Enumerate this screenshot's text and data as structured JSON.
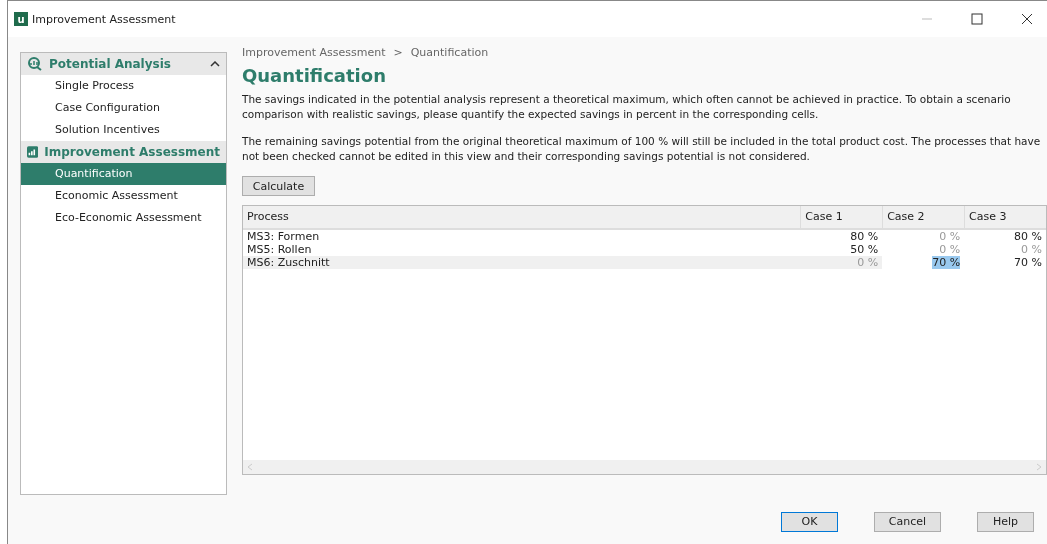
{
  "window": {
    "title": "Improvement Assessment",
    "logo": "u"
  },
  "sidebar": {
    "sections": [
      {
        "kind": "analysis",
        "title": "Potential Analysis",
        "expanded": true,
        "items": [
          {
            "label": "Single Process",
            "selected": false
          },
          {
            "label": "Case Configuration",
            "selected": false
          },
          {
            "label": "Solution Incentives",
            "selected": false
          }
        ]
      },
      {
        "kind": "chart",
        "title": "Improvement Assessment",
        "items": [
          {
            "label": "Quantification",
            "selected": true
          },
          {
            "label": "Economic Assessment",
            "selected": false
          },
          {
            "label": "Eco-Economic Assessment",
            "selected": false
          }
        ]
      }
    ]
  },
  "breadcrumb": [
    "Improvement Assessment",
    "Quantification"
  ],
  "breadcrumb_separator": ">",
  "heading": "Quantification",
  "paragraphs": [
    "The savings indicated in the potential analysis represent a theoretical maximum, which often cannot be achieved in practice. To obtain a scenario comparison with realistic savings, please quantify the expected savings in percent in the corresponding cells.",
    "The remaining savings potential from the original theoretical maximum of 100 % will still be included in the total product cost. The processes that have not been checked cannot be edited in this view and their corresponding savings potential is not considered."
  ],
  "calculate_button": "Calculate",
  "table": {
    "columns": [
      "Process",
      "Case 1",
      "Case 2",
      "Case 3"
    ],
    "rows": [
      {
        "process": "MS3:  Formen",
        "selected": false,
        "cells": [
          {
            "value": "80 %",
            "disabled": false,
            "selected": false
          },
          {
            "value": "0 %",
            "disabled": true,
            "selected": false
          },
          {
            "value": "80 %",
            "disabled": false,
            "selected": false
          }
        ]
      },
      {
        "process": "MS5:  Rollen",
        "selected": false,
        "cells": [
          {
            "value": "50 %",
            "disabled": false,
            "selected": false
          },
          {
            "value": "0 %",
            "disabled": true,
            "selected": false
          },
          {
            "value": "0 %",
            "disabled": true,
            "selected": false
          }
        ]
      },
      {
        "process": "MS6:  Zuschnitt",
        "selected": true,
        "cells": [
          {
            "value": "0 %",
            "disabled": true,
            "selected": false
          },
          {
            "value": "70 %",
            "disabled": false,
            "selected": true
          },
          {
            "value": "70 %",
            "disabled": false,
            "selected": false
          }
        ]
      }
    ]
  },
  "buttons": [
    "OK",
    "Cancel",
    "Help"
  ]
}
